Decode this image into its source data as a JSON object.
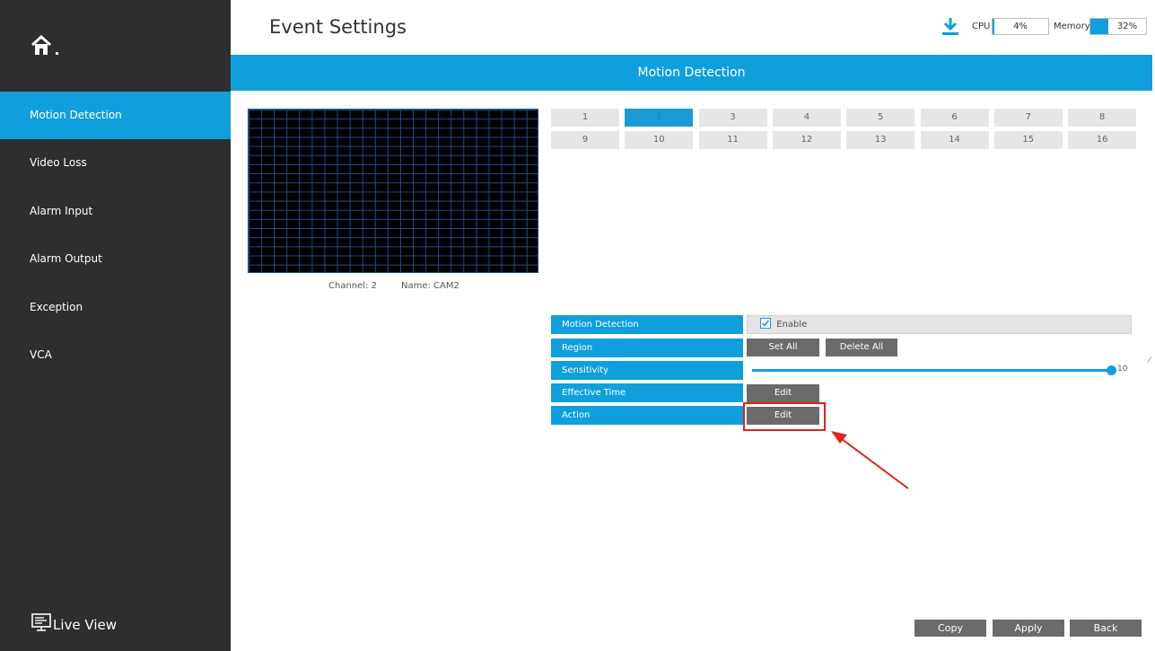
{
  "header": {
    "title": "Event Settings",
    "cpu_label": "CPU",
    "cpu_value": "4%",
    "cpu_fraction": 0.04,
    "memory_label": "Memory",
    "memory_value": "32%",
    "memory_fraction": 0.32
  },
  "sidebar": {
    "items": [
      {
        "label": "Motion Detection",
        "active": true
      },
      {
        "label": "Video Loss"
      },
      {
        "label": "Alarm Input"
      },
      {
        "label": "Alarm Output"
      },
      {
        "label": "Exception"
      },
      {
        "label": "VCA"
      }
    ],
    "live_view": "Live View"
  },
  "section_title": "Motion Detection",
  "preview": {
    "channel": "Channel: 2",
    "name": "Name: CAM2"
  },
  "channels": [
    "1",
    "2",
    "3",
    "4",
    "5",
    "6",
    "7",
    "8",
    "9",
    "10",
    "11",
    "12",
    "13",
    "14",
    "15",
    "16"
  ],
  "active_channel": "2",
  "settings": {
    "motion_detection_label": "Motion Detection",
    "enable_label": "Enable",
    "region_label": "Region",
    "set_all": "Set All",
    "delete_all": "Delete All",
    "sensitivity_label": "Sensitivity",
    "sensitivity_value": "10",
    "effective_time_label": "Effective Time",
    "effective_time_edit": "Edit",
    "action_label": "Action",
    "action_edit": "Edit"
  },
  "footer": {
    "copy": "Copy",
    "apply": "Apply",
    "back": "Back"
  },
  "colors": {
    "accent": "#0f9fdc",
    "sidebar": "#2e2e2e",
    "button": "#6b6b6b",
    "highlight": "#e0221f"
  }
}
